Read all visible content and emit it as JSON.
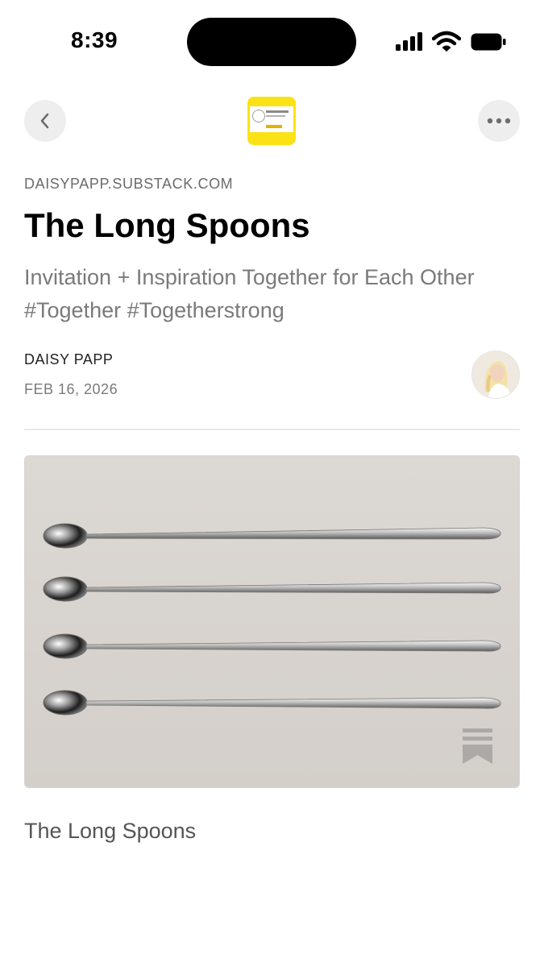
{
  "status_bar": {
    "time": "8:39"
  },
  "nav": {
    "back_icon": "chevron-left-icon",
    "more_icon": "ellipsis-icon",
    "publication_logo_icon": "publication-logo"
  },
  "article": {
    "domain": "DAISYPAPP.SUBSTACK.COM",
    "title": "The Long Spoons",
    "subtitle": "Invitation + Inspiration Together for Each Other #Together #Togetherstrong",
    "author": "DAISY PAPP",
    "date": "FEB 16, 2026",
    "image_caption": "The Long Spoons"
  },
  "colors": {
    "logo_yellow": "#fbe216",
    "title": "#000000",
    "muted": "#7a7a7a",
    "image_background": "#d9d4cf"
  }
}
